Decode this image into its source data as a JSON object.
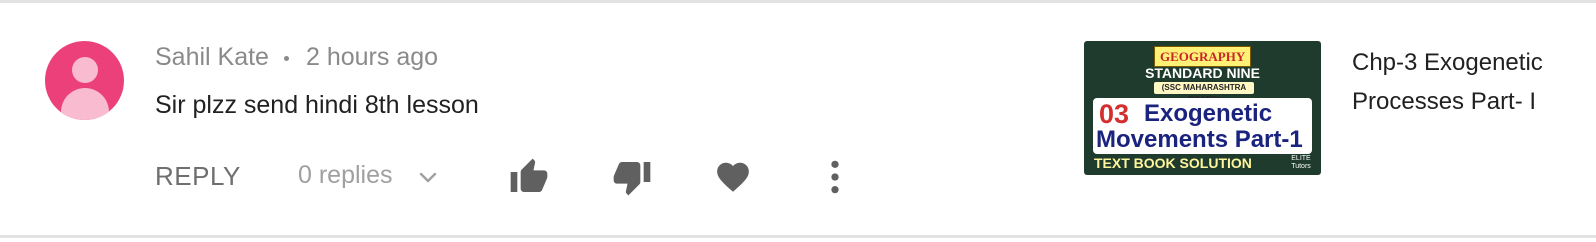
{
  "comment": {
    "author": "Sahil Kate",
    "separator": "•",
    "time": "2 hours ago",
    "text": "Sir plzz send hindi 8th lesson"
  },
  "actions": {
    "reply_label": "REPLY",
    "replies_label": "0 replies",
    "icons": [
      "chevron-down-icon",
      "thumbs-up-icon",
      "thumbs-down-icon",
      "heart-icon",
      "more-vertical-icon"
    ]
  },
  "video": {
    "title": "Chp-3 Exogenetic Processes Part- I",
    "thumbnail": {
      "tag": "GEOGRAPHY",
      "standard": "STANDARD NINE",
      "board": "(SSC MAHARASHTRA BOARD)",
      "number": "03",
      "line1": "Exogenetic",
      "line2": "Movements Part-1",
      "footer": "TEXT BOOK SOLUTION",
      "brand": "ELITE",
      "brand_sub": "Tutors"
    }
  },
  "colors": {
    "avatar": "#ec407a",
    "avatar_figure": "#f8bbd0",
    "muted_text": "#8a8a8a",
    "icon": "#606060",
    "thumb_bg": "#1e3b2d"
  }
}
